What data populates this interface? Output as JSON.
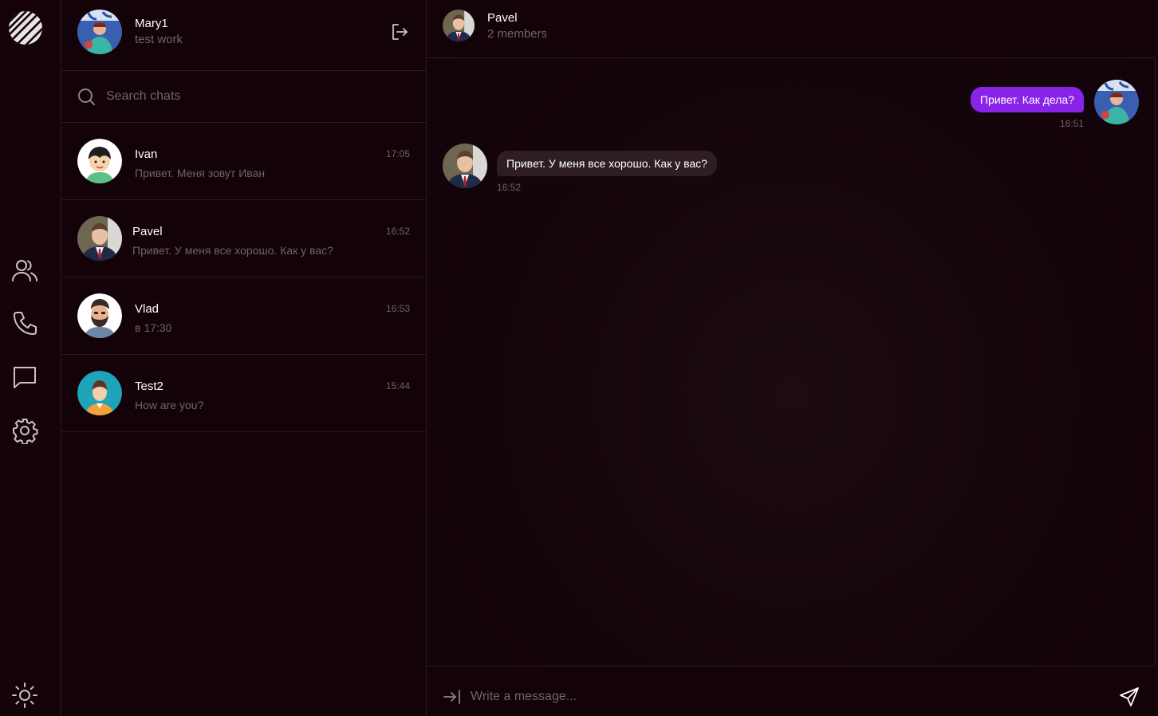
{
  "rail": {
    "icons": [
      "logo-icon",
      "contacts-icon",
      "phone-icon",
      "chat-icon",
      "settings-icon",
      "theme-sun-icon"
    ]
  },
  "profile": {
    "name": "Mary1",
    "status": "test work",
    "logout_icon": "logout-icon"
  },
  "search": {
    "placeholder": "Search chats"
  },
  "chats": [
    {
      "name": "Ivan",
      "preview": "Привет. Меня зовут Иван",
      "time": "17:05"
    },
    {
      "name": "Pavel",
      "preview": "Привет. У меня все хорошо. Как у вас?",
      "time": "16:52"
    },
    {
      "name": "Vlad",
      "preview": "в 17:30",
      "time": "16:53"
    },
    {
      "name": "Test2",
      "preview": "How are you?",
      "time": "15:44"
    }
  ],
  "chat_header": {
    "name": "Pavel",
    "members": "2 members"
  },
  "messages": [
    {
      "direction": "out",
      "text": "Привет. Как дела?",
      "time": "16:51"
    },
    {
      "direction": "in",
      "text": "Привет. У меня все хорошо. Как у вас?",
      "time": "16:52"
    }
  ],
  "composer": {
    "placeholder": "Write a message..."
  },
  "colors": {
    "background": "#140209",
    "accent": "#8a23e8",
    "incoming_bubble": "#2e1e24",
    "muted_text": "#6e6468",
    "border": "#2c1a21"
  }
}
